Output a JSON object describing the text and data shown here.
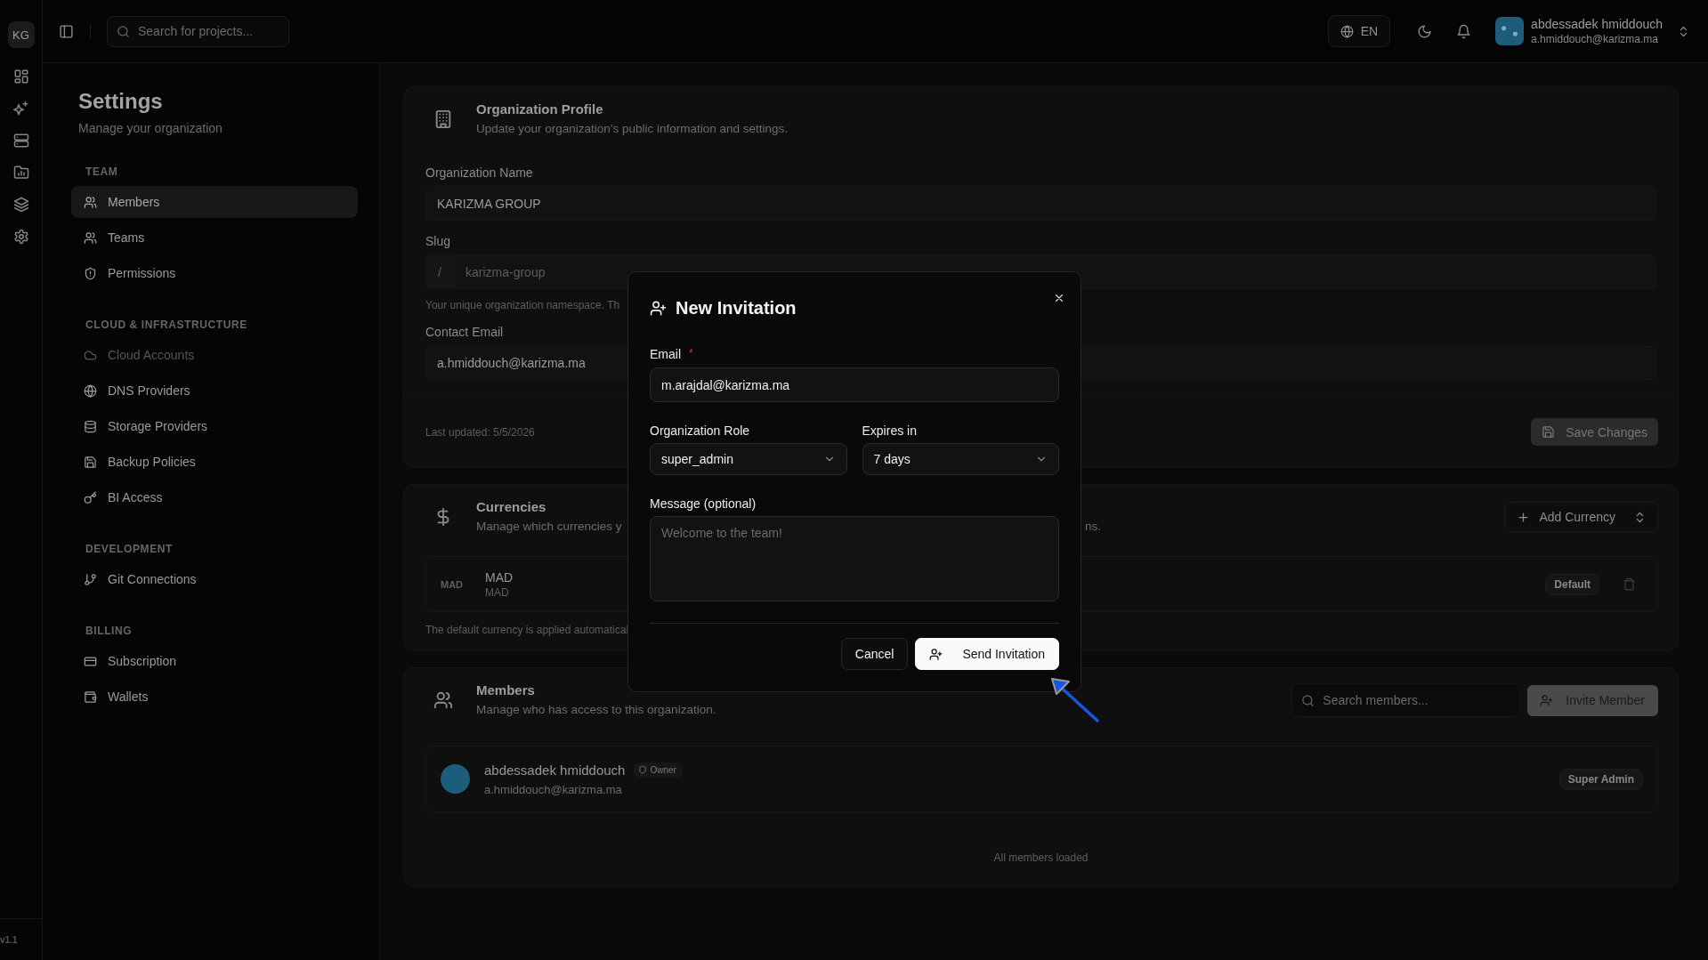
{
  "rail": {
    "logo": "KG",
    "version": "v1.1"
  },
  "topbar": {
    "search": {
      "placeholder": "Search for projects..."
    },
    "language": "EN",
    "user": {
      "name": "abdessadek hmiddouch",
      "email": "a.hmiddouch@karizma.ma"
    }
  },
  "sidebar": {
    "title": "Settings",
    "subtitle": "Manage your organization",
    "sections": [
      {
        "heading": "TEAM",
        "items": [
          {
            "label": "Members",
            "selected": true,
            "disabled": false
          },
          {
            "label": "Teams",
            "selected": false,
            "disabled": false
          },
          {
            "label": "Permissions",
            "selected": false,
            "disabled": false
          }
        ]
      },
      {
        "heading": "CLOUD & INFRASTRUCTURE",
        "items": [
          {
            "label": "Cloud Accounts",
            "selected": false,
            "disabled": true
          },
          {
            "label": "DNS Providers",
            "selected": false,
            "disabled": false
          },
          {
            "label": "Storage Providers",
            "selected": false,
            "disabled": false
          },
          {
            "label": "Backup Policies",
            "selected": false,
            "disabled": false
          },
          {
            "label": "BI Access",
            "selected": false,
            "disabled": false
          }
        ]
      },
      {
        "heading": "DEVELOPMENT",
        "items": [
          {
            "label": "Git Connections",
            "selected": false,
            "disabled": false
          }
        ]
      },
      {
        "heading": "BILLING",
        "items": [
          {
            "label": "Subscription",
            "selected": false,
            "disabled": false
          },
          {
            "label": "Wallets",
            "selected": false,
            "disabled": false
          }
        ]
      }
    ]
  },
  "profile": {
    "title": "Organization Profile",
    "subtitle": "Update your organization's public information and settings.",
    "fields": [
      {
        "label": "Organization Name",
        "value": "KARIZMA GROUP",
        "disabled": false
      },
      {
        "label": "Slug",
        "prefix": "/",
        "value": "karizma-group",
        "disabled": true,
        "hint": "Your unique organization namespace. Th"
      },
      {
        "label": "Contact Email",
        "value": "a.hmiddouch@karizma.ma",
        "disabled": false
      }
    ],
    "last_updated": "Last updated: 5/5/2026",
    "save_button": {
      "label": "Save Changes",
      "disabled": true
    }
  },
  "currencies": {
    "title": "Currencies",
    "subtitle": [
      "Manage which currencies y",
      "ns."
    ],
    "add_button": "Add Currency",
    "rows": [
      {
        "code": "MAD",
        "name": "MAD",
        "subtitle": "MAD",
        "badge": "Default"
      }
    ],
    "footnote": "The default currency is applied automatical"
  },
  "members": {
    "title": "Members",
    "subtitle": "Manage who has access to this organization.",
    "search": {
      "placeholder": "Search members..."
    },
    "invite_button": "Invite Member",
    "rows": [
      {
        "name": "abdessadek hmiddouch",
        "badge": "Owner",
        "email": "a.hmiddouch@karizma.ma",
        "role": "Super Admin"
      }
    ],
    "footer": "All members loaded"
  },
  "dialog": {
    "title": "New Invitation",
    "email": {
      "label": "Email",
      "required_mark": "*",
      "value": "m.arajdal@karizma.ma"
    },
    "role": {
      "label": "Organization Role",
      "value": "super_admin"
    },
    "expires": {
      "label": "Expires in",
      "value": "7 days"
    },
    "message": {
      "label": "Message (optional)",
      "placeholder": "Welcome to the team!"
    },
    "buttons": [
      {
        "label": "Cancel",
        "kind": "secondary"
      },
      {
        "label": "Send Invitation",
        "kind": "primary"
      }
    ]
  }
}
